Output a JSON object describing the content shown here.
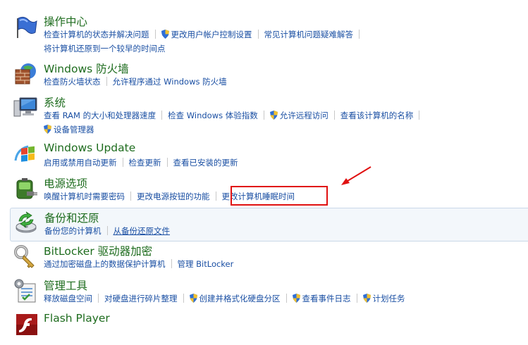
{
  "sections": [
    {
      "title": "操作中心",
      "icon": "flag-icon",
      "rows": [
        [
          {
            "text": "检查计算机的状态并解决问题"
          },
          {
            "text": "更改用户帐户控制设置",
            "shield": true
          },
          {
            "text": "常见计算机问题疑难解答"
          }
        ],
        [
          {
            "text": "将计算机还原到一个较早的时间点"
          }
        ]
      ]
    },
    {
      "title": "Windows 防火墙",
      "icon": "firewall-icon",
      "rows": [
        [
          {
            "text": "检查防火墙状态"
          },
          {
            "text": "允许程序通过 Windows 防火墙"
          }
        ]
      ]
    },
    {
      "title": "系统",
      "icon": "system-monitor-icon",
      "rows": [
        [
          {
            "text": "查看 RAM 的大小和处理器速度"
          },
          {
            "text": "检查 Windows 体验指数"
          },
          {
            "text": "允许远程访问",
            "shield": true
          },
          {
            "text": "查看该计算机的名称"
          }
        ],
        [
          {
            "text": "设备管理器",
            "shield": true
          }
        ]
      ]
    },
    {
      "title": "Windows Update",
      "icon": "windows-update-icon",
      "rows": [
        [
          {
            "text": "启用或禁用自动更新"
          },
          {
            "text": "检查更新"
          },
          {
            "text": "查看已安装的更新"
          }
        ]
      ]
    },
    {
      "title": "电源选项",
      "icon": "battery-plug-icon",
      "rows": [
        [
          {
            "text": "唤醒计算机时需要密码"
          },
          {
            "text": "更改电源按钮的功能"
          },
          {
            "text": "更改计算机睡眠时间"
          }
        ]
      ]
    },
    {
      "title": "备份和还原",
      "icon": "backup-disk-icon",
      "rows": [
        [
          {
            "text": "备份您的计算机"
          },
          {
            "text": "从备份还原文件",
            "underline": true
          }
        ]
      ]
    },
    {
      "title": "BitLocker 驱动器加密",
      "icon": "bitlocker-key-icon",
      "rows": [
        [
          {
            "text": "通过加密磁盘上的数据保护计算机"
          },
          {
            "text": "管理 BitLocker"
          }
        ]
      ]
    },
    {
      "title": "管理工具",
      "icon": "admin-tools-icon",
      "rows": [
        [
          {
            "text": "释放磁盘空间"
          },
          {
            "text": "对硬盘进行碎片整理"
          },
          {
            "text": "创建并格式化硬盘分区",
            "shield": true
          },
          {
            "text": "查看事件日志",
            "shield": true
          },
          {
            "text": "计划任务",
            "shield": true
          }
        ]
      ]
    },
    {
      "title": "Flash Player",
      "icon": "flash-player-icon",
      "rows": []
    }
  ]
}
